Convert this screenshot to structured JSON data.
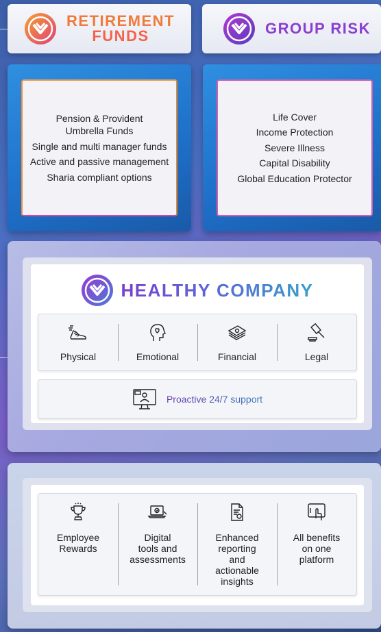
{
  "retirement": {
    "title_line1": "RETIREMENT",
    "title_line2": "FUNDS",
    "items": [
      "Pension & Provident",
      "Umbrella Funds",
      "Single and multi manager funds",
      "Active and passive management",
      "Sharia compliant options"
    ]
  },
  "group_risk": {
    "title": "GROUP RISK",
    "items": [
      "Life Cover",
      "Income Protection",
      "Severe Illness",
      "Capital Disability",
      "Global Education Protector"
    ]
  },
  "healthy_company": {
    "title": "HEALTHY COMPANY",
    "pillars": [
      {
        "label": "Physical",
        "icon": "running-shoe-icon"
      },
      {
        "label": "Emotional",
        "icon": "head-heart-icon"
      },
      {
        "label": "Financial",
        "icon": "money-stack-icon"
      },
      {
        "label": "Legal",
        "icon": "gavel-icon"
      }
    ],
    "support": {
      "label": "Proactive 24/7 support",
      "icon": "monitor-support-icon"
    }
  },
  "benefits": [
    {
      "lines": [
        "Employee",
        "Rewards"
      ],
      "icon": "trophy-icon"
    },
    {
      "lines": [
        "Digital",
        "tools and",
        "assessments"
      ],
      "icon": "laptop-icon"
    },
    {
      "lines": [
        "Enhanced",
        "reporting",
        "and",
        "actionable",
        "insights"
      ],
      "icon": "report-document-icon"
    },
    {
      "lines": [
        "All benefits",
        "on one",
        "platform"
      ],
      "icon": "tablet-touch-icon"
    }
  ],
  "colors": {
    "retirement_title": "#f07a3a",
    "group_risk_title": "#8a3fd0",
    "healthy_title_start": "#7a3fd0",
    "healthy_title_end": "#38a0c8"
  }
}
